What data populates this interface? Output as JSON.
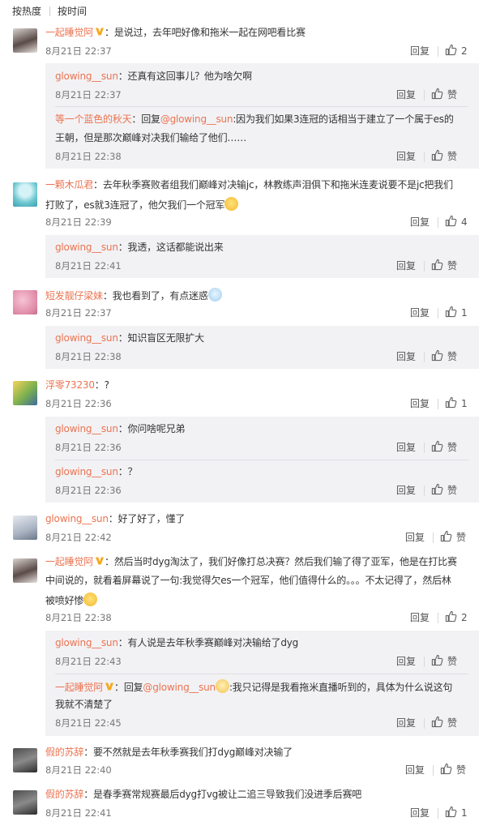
{
  "tabs": [
    "按热度",
    "按时间"
  ],
  "labels": {
    "reply": "回复",
    "like": "赞"
  },
  "comments": [
    {
      "name": "一起睡觉阿",
      "text": "：是说过，去年吧好像和拖米一起在网吧看比赛",
      "time": "8月21日 22:37",
      "likes": "2",
      "replies": [
        {
          "name": "glowing__sun",
          "text": "：还真有这回事儿？他为啥欠啊",
          "time": "8月21日 22:37",
          "likes": "赞"
        },
        {
          "name": "等一个蓝色的秋天",
          "text_pre": "：回复",
          "mention": "@glowing__sun",
          "text": ":因为我们如果3连冠的话相当于建立了一个属于es的",
          "text2": "王朝，但是那次巅峰对决我们输给了他们……",
          "time": "8月21日 22:38",
          "likes": "赞"
        }
      ]
    },
    {
      "name": "一颗木瓜君",
      "text": "：去年秋季赛败者组我们巅峰对决输jc，林教练声泪俱下和拖米连麦说要不是jc把我们",
      "text2": "打败了，es就3连冠了，他欠我们一个冠军",
      "time": "8月21日 22:39",
      "likes": "4",
      "replies": [
        {
          "name": "glowing__sun",
          "text": "：我透，这话都能说出来",
          "time": "8月21日 22:41",
          "likes": "赞"
        }
      ]
    },
    {
      "name": "短发靓仔梁妹",
      "text": "：我也看到了，有点迷惑",
      "time": "8月21日 22:37",
      "likes": "1",
      "replies": [
        {
          "name": "glowing__sun",
          "text": "：知识盲区无限扩大",
          "time": "8月21日 22:38",
          "likes": "赞"
        }
      ]
    },
    {
      "name": "浮零73230",
      "text": "：?",
      "time": "8月21日 22:36",
      "likes": "1",
      "replies": [
        {
          "name": "glowing__sun",
          "text": "：你问啥呢兄弟",
          "time": "8月21日 22:36",
          "likes": "赞"
        },
        {
          "name": "glowing__sun",
          "text": "：？",
          "time": "8月21日 22:36",
          "likes": "赞"
        }
      ]
    },
    {
      "name": "glowing__sun",
      "text": "：好了好了，懂了",
      "time": "8月21日 22:42",
      "likes": "赞",
      "replies": []
    },
    {
      "name": "一起睡觉阿",
      "text": "：然后当时dyg淘汰了，我们好像打总决赛？然后我们输了得了亚军，他是在打比赛",
      "text2": "中间说的，就看着屏幕说了一句:我觉得欠es一个冠军，他们值得什么的。。。不太记得了，然后林",
      "text3": "被喷好惨",
      "time": "8月21日 22:38",
      "likes": "2",
      "replies": [
        {
          "name": "glowing__sun",
          "text": "：有人说是去年秋季赛巅峰对决输给了dyg",
          "time": "8月21日 22:43",
          "likes": "赞"
        },
        {
          "name": "一起睡觉阿",
          "text_pre": "：回复",
          "mention": "@glowing__sun",
          "text": ":我只记得是我看拖米直播听到的，具体为什么说这句",
          "text2": "我就不清楚了",
          "time": "8月21日 22:45",
          "likes": "赞"
        }
      ]
    },
    {
      "name": "假的苏辞",
      "text": "：要不然就是去年秋季赛我们打dyg巅峰对决输了",
      "time": "8月21日 22:40",
      "likes": "赞",
      "replies": []
    },
    {
      "name": "假的苏辞",
      "text": "：是春季赛常规赛最后dyg打vg被让二追三导致我们没进季后赛吧",
      "time": "8月21日 22:41",
      "likes": "1",
      "replies": []
    }
  ]
}
